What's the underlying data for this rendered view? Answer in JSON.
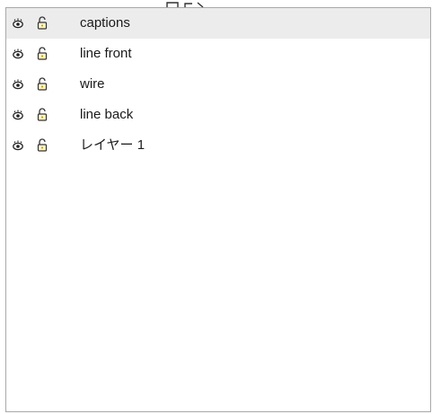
{
  "layers_panel": {
    "selected_index": 0,
    "layers": [
      {
        "name": "captions",
        "visible": true,
        "locked": false,
        "icons": [
          "eye-icon",
          "unlocked-icon"
        ]
      },
      {
        "name": "line front",
        "visible": true,
        "locked": false,
        "icons": [
          "eye-icon",
          "unlocked-icon"
        ]
      },
      {
        "name": "wire",
        "visible": true,
        "locked": false,
        "icons": [
          "eye-icon",
          "unlocked-icon"
        ]
      },
      {
        "name": "line back",
        "visible": true,
        "locked": false,
        "icons": [
          "eye-icon",
          "unlocked-icon"
        ]
      },
      {
        "name": "レイヤー 1",
        "visible": true,
        "locked": false,
        "icons": [
          "eye-icon",
          "unlocked-icon"
        ]
      }
    ]
  },
  "colors": {
    "selected_row_bg": "#ececec",
    "border": "#a8a8a8",
    "text": "#1a1a1a",
    "lock_accent": "#c8a000"
  }
}
